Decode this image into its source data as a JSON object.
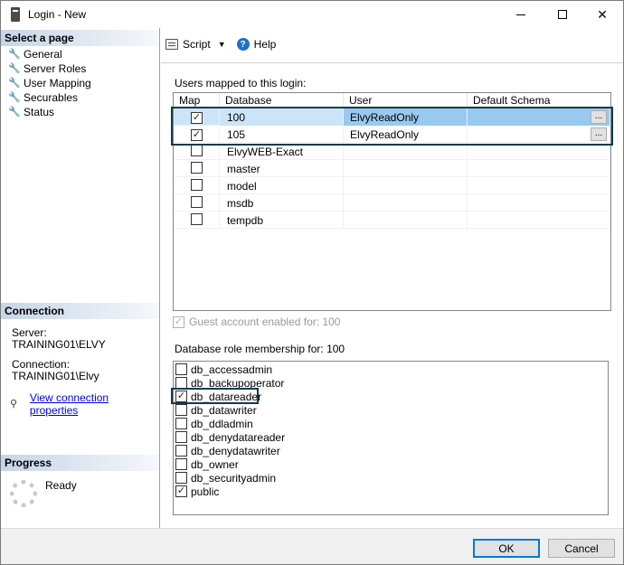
{
  "window": {
    "title": "Login - New"
  },
  "left": {
    "select_page_header": "Select a page",
    "pages": [
      "General",
      "Server Roles",
      "User Mapping",
      "Securables",
      "Status"
    ],
    "connection_header": "Connection",
    "server_label": "Server:",
    "server_value": "TRAINING01\\ELVY",
    "connection_label": "Connection:",
    "connection_value": "TRAINING01\\Elvy",
    "view_connection_link": "View connection properties",
    "progress_header": "Progress",
    "progress_status": "Ready"
  },
  "toolbar": {
    "script_label": "Script",
    "help_label": "Help"
  },
  "mapping": {
    "label": "Users mapped to this login:",
    "columns": [
      "Map",
      "Database",
      "User",
      "Default Schema"
    ],
    "rows": [
      {
        "map": true,
        "database": "100",
        "user": "ElvyReadOnly",
        "schema": "",
        "selected": true
      },
      {
        "map": true,
        "database": "105",
        "user": "ElvyReadOnly",
        "schema": "",
        "selected": false
      },
      {
        "map": false,
        "database": "ElvyWEB-Exact",
        "user": "",
        "schema": ""
      },
      {
        "map": false,
        "database": "master",
        "user": "",
        "schema": ""
      },
      {
        "map": false,
        "database": "model",
        "user": "",
        "schema": ""
      },
      {
        "map": false,
        "database": "msdb",
        "user": "",
        "schema": ""
      },
      {
        "map": false,
        "database": "tempdb",
        "user": "",
        "schema": ""
      }
    ],
    "ellipsis_label": "..."
  },
  "guest": {
    "label": "Guest account enabled for: 100",
    "checked": true
  },
  "roles": {
    "label": "Database role membership for: 100",
    "items": [
      {
        "name": "db_accessadmin",
        "checked": false
      },
      {
        "name": "db_backupoperator",
        "checked": false
      },
      {
        "name": "db_datareader",
        "checked": true
      },
      {
        "name": "db_datawriter",
        "checked": false
      },
      {
        "name": "db_ddladmin",
        "checked": false
      },
      {
        "name": "db_denydatareader",
        "checked": false
      },
      {
        "name": "db_denydatawriter",
        "checked": false
      },
      {
        "name": "db_owner",
        "checked": false
      },
      {
        "name": "db_securityadmin",
        "checked": false
      },
      {
        "name": "public",
        "checked": true
      }
    ]
  },
  "footer": {
    "ok_label": "OK",
    "cancel_label": "Cancel"
  }
}
